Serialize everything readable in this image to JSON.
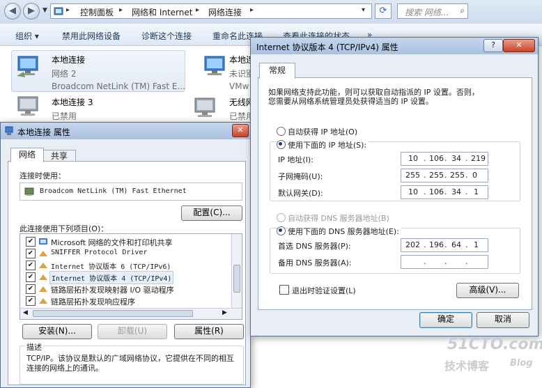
{
  "explorer": {
    "breadcrumb": [
      "控制面板",
      "网络和 Internet",
      "网络连接"
    ],
    "search_placeholder": "搜索 网络...",
    "toolbar": [
      "组织 ▾",
      "禁用此网络设备",
      "诊断这个连接",
      "重命名此连接",
      "查看此连接的状态",
      "»"
    ],
    "connections": [
      {
        "name": "本地连接",
        "status": "网络  2",
        "device": "Broadcom NetLink (TM) Fast E..."
      },
      {
        "name": "本地连",
        "status": "未识别",
        "device": "VMw"
      },
      {
        "name": "本地连接 3",
        "status": "已禁用",
        "device": ""
      },
      {
        "name": "无线网",
        "status": "已禁用",
        "device": ""
      }
    ]
  },
  "local_props": {
    "title": "本地连接 属性",
    "tabs": [
      "网络",
      "共享"
    ],
    "connect_using_label": "连接时使用：",
    "adapter": "Broadcom NetLink (TM) Fast Ethernet",
    "configure_button": "配置(C)...",
    "items_label": "此连接使用下列项目(O)：",
    "items": [
      {
        "label": "Microsoft 网络的文件和打印机共享",
        "checked": true
      },
      {
        "label": "SNIFFER Protocol Driver",
        "checked": true
      },
      {
        "label": "Internet 协议版本 6 (TCP/IPv6)",
        "checked": true
      },
      {
        "label": "Internet 协议版本 4 (TCP/IPv4)",
        "checked": true
      },
      {
        "label": "链路层拓扑发现映射器 I/O 驱动程序",
        "checked": true
      },
      {
        "label": "链路层拓扑发现响应程序",
        "checked": true
      }
    ],
    "install_button": "安装(N)...",
    "uninstall_button": "卸载(U)",
    "properties_button": "属性(R)",
    "description_title": "描述",
    "description": "TCP/IP。该协议是默认的广域网络协议，它提供在不同的相互连接的网络上的通讯。"
  },
  "ipv4": {
    "title": "Internet 协议版本 4 (TCP/IPv4) 属性",
    "tab": "常规",
    "intro_line1": "如果网络支持此功能，则可以获取自动指派的 IP 设置。否则，",
    "intro_line2": "您需要从网络系统管理员处获得适当的 IP 设置。",
    "auto_ip": "自动获得 IP 地址(O)",
    "manual_ip": "使用下面的 IP 地址(S):",
    "ip_label": "IP 地址(I):",
    "ip_value": [
      "10",
      "106",
      "34",
      "219"
    ],
    "mask_label": "子网掩码(U):",
    "mask_value": [
      "255",
      "255",
      "255",
      "0"
    ],
    "gateway_label": "默认网关(D):",
    "gateway_value": [
      "10",
      "106",
      "34",
      "1"
    ],
    "auto_dns": "自动获得 DNS 服务器地址(B)",
    "manual_dns": "使用下面的 DNS 服务器地址(E):",
    "pref_dns_label": "首选 DNS 服务器(P):",
    "pref_dns_value": [
      "202",
      "196",
      "64",
      "1"
    ],
    "alt_dns_label": "备用 DNS 服务器(A):",
    "validate_label": "退出时验证设置(L)",
    "advanced_button": "高级(V)...",
    "ok_button": "确定",
    "cancel_button": "取消"
  },
  "watermark": {
    "line1": "51CTO.com",
    "line2": "技术博客",
    "line3": "Blog"
  }
}
